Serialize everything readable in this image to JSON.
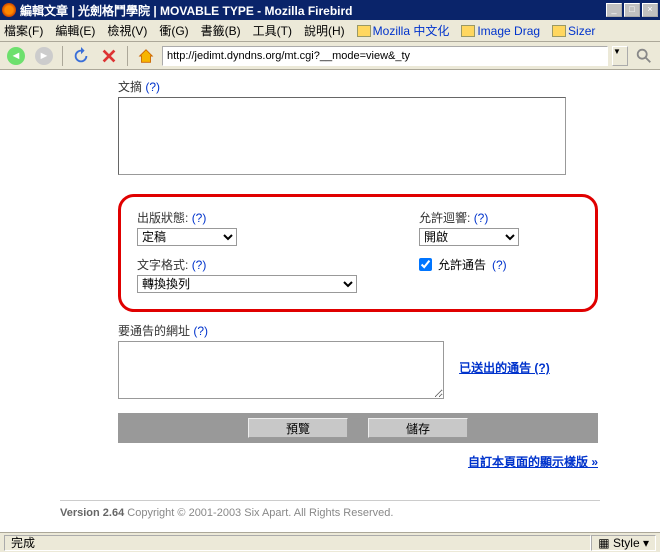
{
  "window": {
    "title": "編輯文章 | 光劍格鬥學院 | MOVABLE TYPE - Mozilla Firebird"
  },
  "menu": {
    "file": "檔案(F)",
    "edit": "編輯(E)",
    "view": "檢視(V)",
    "go": "衝(G)",
    "bookmarks": "書籤(B)",
    "tools": "工具(T)",
    "help": "說明(H)",
    "link1": "Mozilla 中文化",
    "link2": "Image Drag",
    "link3": "Sizer"
  },
  "url": "http://jedimt.dyndns.org/mt.cgi?__mode=view&_ty",
  "excerpt": {
    "label": "文摘",
    "help": "(?)"
  },
  "status": {
    "label": "出版狀態:",
    "help": "(?)",
    "value": "定稿"
  },
  "format": {
    "label": "文字格式:",
    "help": "(?)",
    "value": "轉換換列"
  },
  "comments": {
    "label": "允許迴響:",
    "help": "(?)",
    "value": "開啟"
  },
  "pings": {
    "label": "允許通告",
    "help": "(?)"
  },
  "ping_urls": {
    "label": "要通告的網址",
    "help": "(?)"
  },
  "sent_pings": "已送出的通告 (?)",
  "buttons": {
    "preview": "預覽",
    "save": "儲存"
  },
  "customize": "自訂本頁面的顯示樣版 »",
  "footer": {
    "version": "Version 2.64",
    "copy": " Copyright © 2001-2003 Six Apart. All Rights Reserved."
  },
  "status_text": "完成",
  "style_label": "Style"
}
